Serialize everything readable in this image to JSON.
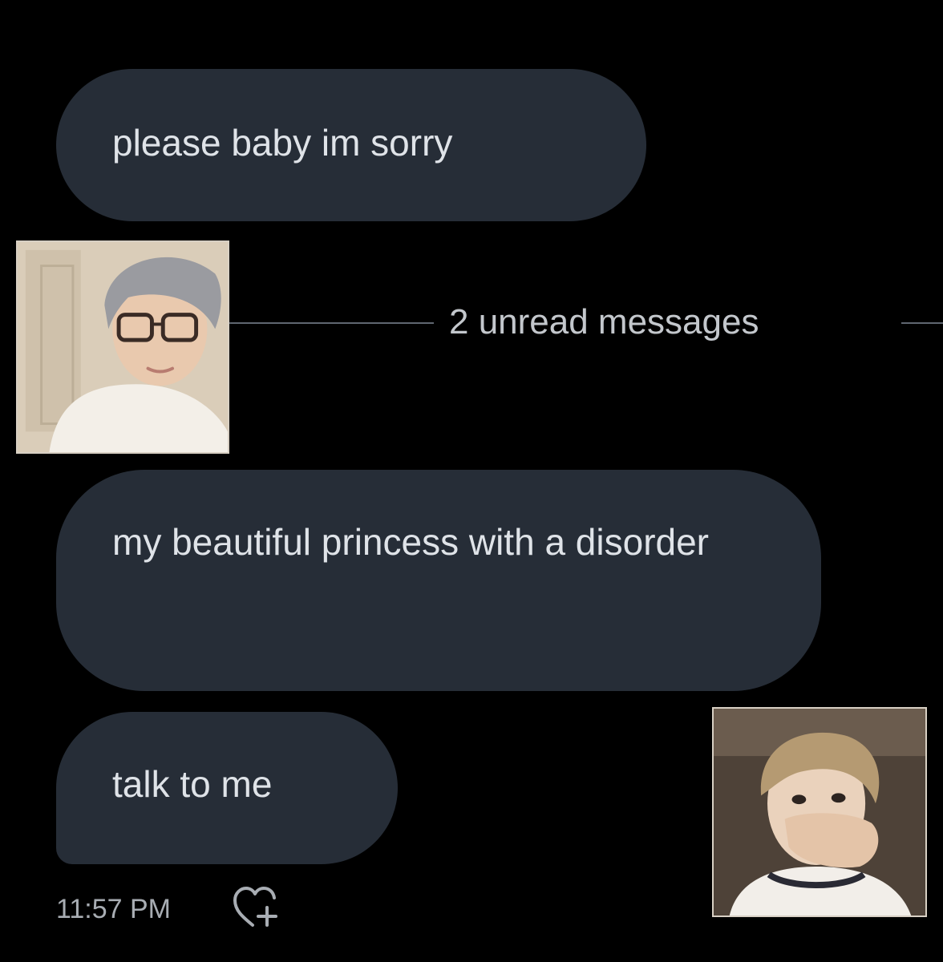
{
  "messages": [
    {
      "text": "please baby im sorry"
    },
    {
      "text": "my beautiful princess with a disorder"
    },
    {
      "text": "talk to me"
    }
  ],
  "divider": {
    "label": "2 unread messages"
  },
  "footer": {
    "time": "11:57 PM",
    "reaction_icon": "heart-plus-icon"
  },
  "photos": [
    {
      "icon": "avatar-photo-glasses"
    },
    {
      "icon": "avatar-photo-covering-mouth"
    }
  ],
  "colors": {
    "background": "#000000",
    "bubble": "#262d37",
    "bubble_text": "#dfe3e8",
    "muted_text": "#a8adb3",
    "divider": "#5f6670"
  }
}
